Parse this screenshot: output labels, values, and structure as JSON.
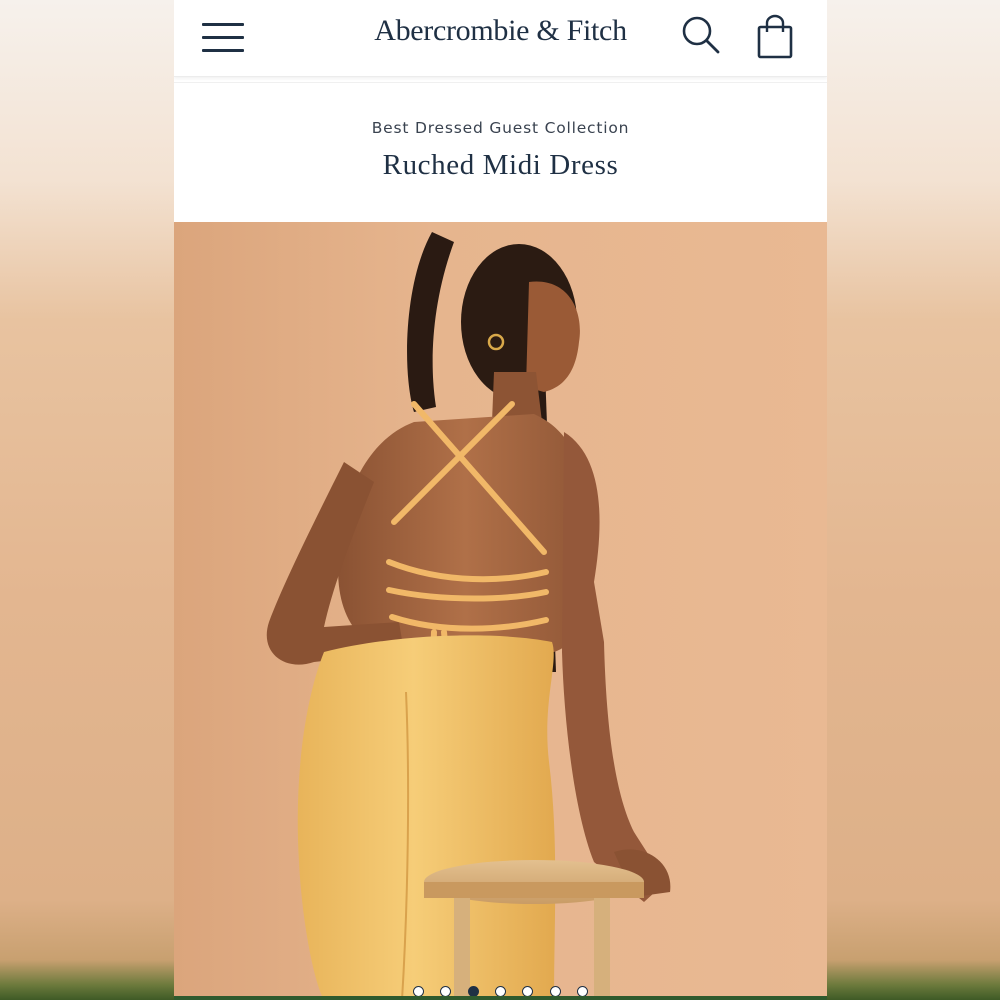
{
  "header": {
    "brand": "Abercrombie & Fitch",
    "menu_icon": "hamburger-menu-icon",
    "search_icon": "search-icon",
    "bag_icon": "shopping-bag-icon"
  },
  "product": {
    "collection": "Best Dressed Guest Collection",
    "title": "Ruched Midi Dress"
  },
  "gallery": {
    "total_images": 7,
    "active_index": 3
  },
  "colors": {
    "brand_navy": "#1f3044",
    "dress_yellow": "#f1c26c",
    "backdrop": "#e6b58e",
    "accent_green": "#2f5a2e"
  }
}
